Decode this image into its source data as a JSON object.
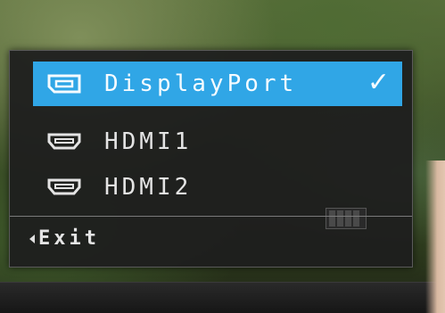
{
  "menu": {
    "items": [
      {
        "label": "DisplayPort",
        "icon": "displayport-icon",
        "selected": true,
        "check": "✓"
      },
      {
        "label": "HDMI1",
        "icon": "hdmi-icon",
        "selected": false
      },
      {
        "label": "HDMI2",
        "icon": "hdmi-icon",
        "selected": false
      }
    ],
    "exit_label": "Exit"
  },
  "colors": {
    "selected_bg": "#30a6e6",
    "osd_bg": "#1e1e1e",
    "text": "#e4e4e4"
  }
}
